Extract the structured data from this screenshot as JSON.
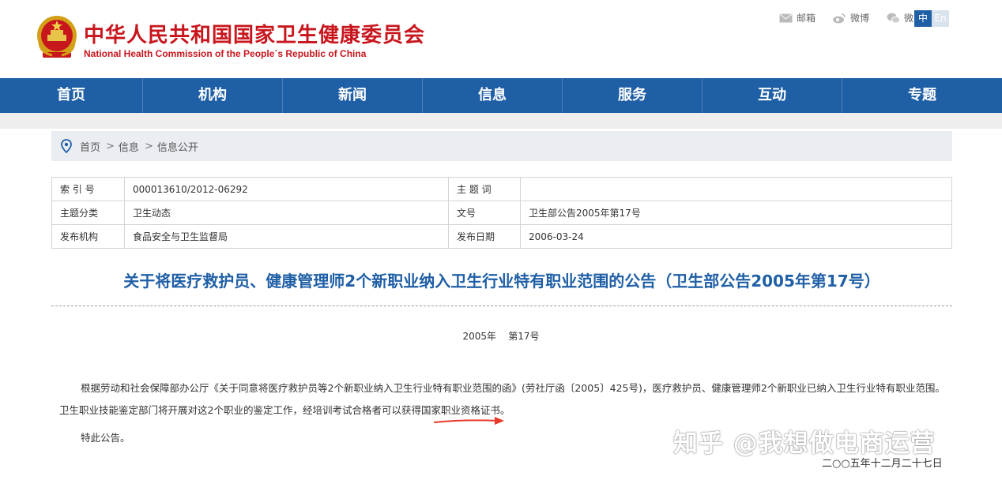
{
  "site": {
    "title_cn": "中华人民共和国国家卫生健康委员会",
    "title_en": "National Health Commission of the People´s Republic of China"
  },
  "top_links": [
    {
      "label": "邮箱",
      "icon": "mail-icon"
    },
    {
      "label": "微博",
      "icon": "weibo-icon"
    },
    {
      "label": "微信",
      "icon": "wechat-icon"
    }
  ],
  "lang": {
    "zh": "中",
    "en": "En"
  },
  "nav": [
    "首页",
    "机构",
    "新闻",
    "信息",
    "服务",
    "互动",
    "专题"
  ],
  "breadcrumb": {
    "home": "首页",
    "sep": ">",
    "level1": "信息",
    "level2": "信息公开"
  },
  "meta": {
    "index_label": "索 引 号",
    "index_value": "000013610/2012-06292",
    "subject_label": "主 题 词",
    "subject_value": "",
    "category_label": "主题分类",
    "category_value": "卫生动态",
    "docno_label": "文号",
    "docno_value": "卫生部公告2005年第17号",
    "issuer_label": "发布机构",
    "issuer_value": "食品安全与卫生监督局",
    "date_label": "发布日期",
    "date_value": "2006-03-24"
  },
  "doc": {
    "title": "关于将医疗救护员、健康管理师2个新职业纳入卫生行业特有职业范围的公告（卫生部公告2005年第17号）",
    "number": "2005年    第17号",
    "body": "根据劳动和社会保障部办公厅《关于同意将医疗救护员等2个新职业纳入卫生行业特有职业范围的函》(劳社厅函〔2005〕425号)，医疗救护员、健康管理师2个新职业已纳入卫生行业特有职业范围。卫生职业技能鉴定部门将开展对这2个职业的鉴定工作，经培训考试合格者可以获得国家职业资格证书。",
    "closing": "特此公告。",
    "signed_date": "二○○五年十二月二十七日"
  },
  "watermark": "知乎 @我想做电商运营",
  "colors": {
    "brand_red": "#c8161d",
    "nav_blue": "#1f5fa6",
    "arrow_red": "#e8392b"
  }
}
